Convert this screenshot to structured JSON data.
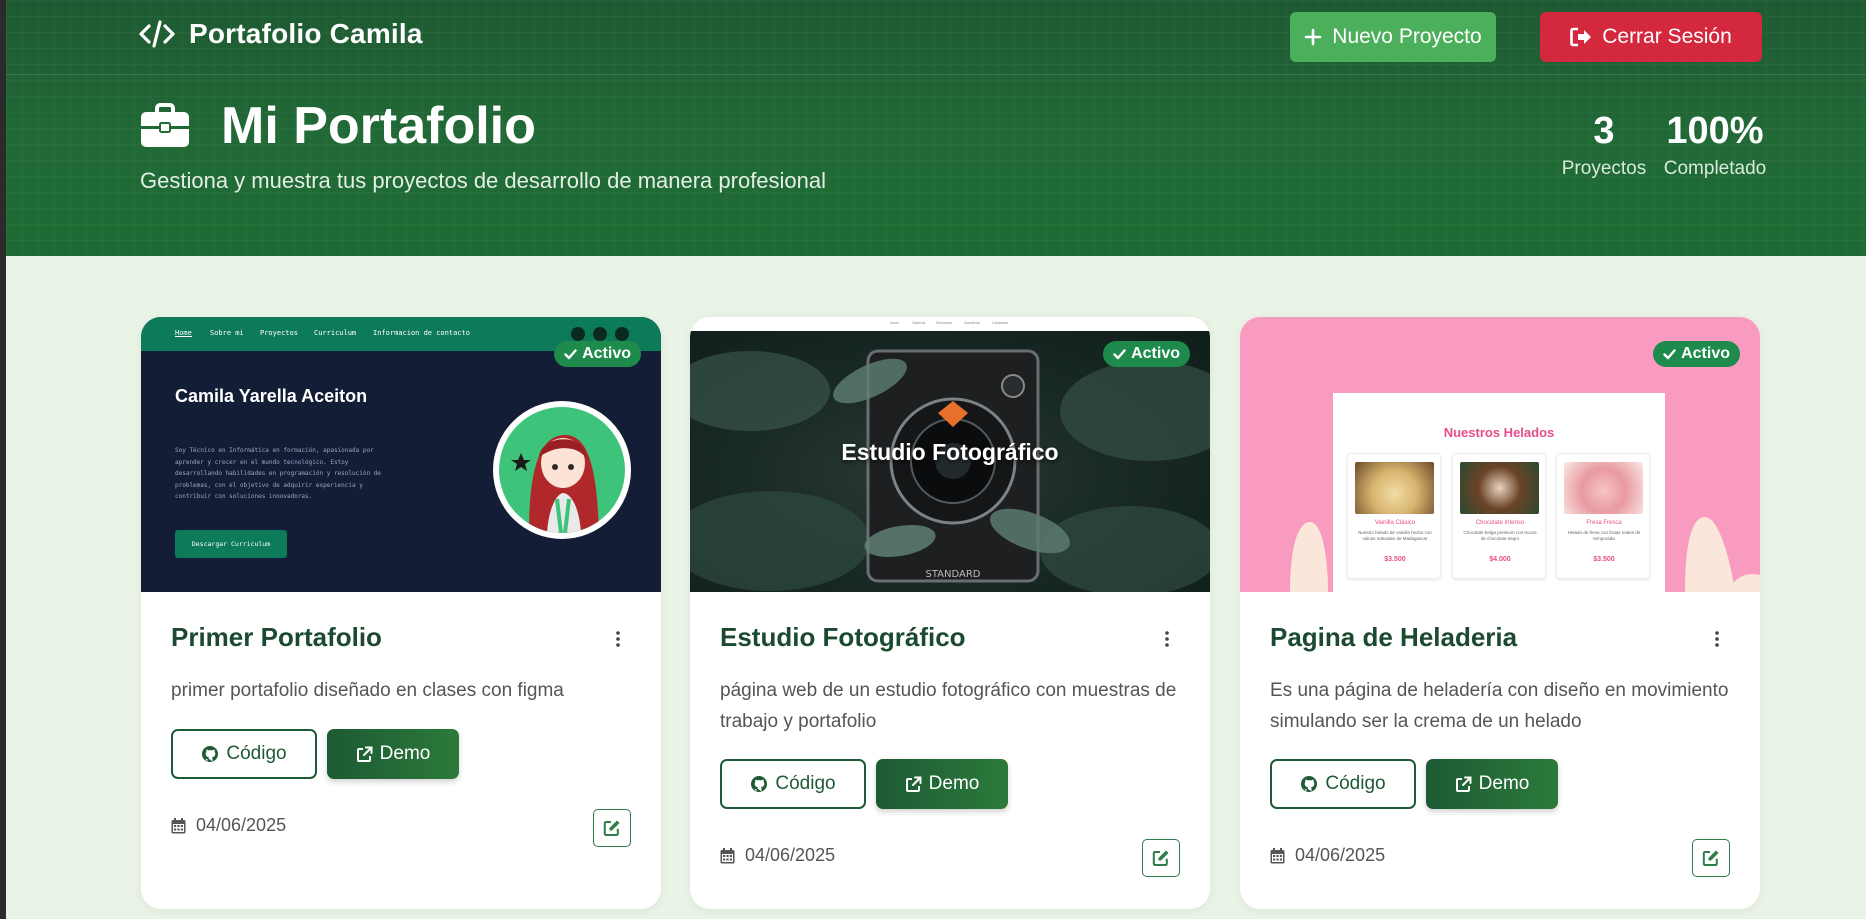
{
  "navbar": {
    "brand": "Portafolio Camila",
    "new_project_label": "Nuevo Proyecto",
    "logout_label": "Cerrar Sesión"
  },
  "hero": {
    "title": "Mi Portafolio",
    "subtitle": "Gestiona y muestra tus proyectos de desarrollo de manera profesional",
    "stats": [
      {
        "value": "3",
        "label": "Proyectos"
      },
      {
        "value": "100%",
        "label": "Completado"
      }
    ]
  },
  "projects": [
    {
      "title": "Primer Portafolio",
      "description": "primer portafolio diseñado en clases con figma",
      "status": "Activo",
      "code_label": "Código",
      "demo_label": "Demo",
      "date": "04/06/2025",
      "thumbnail": {
        "nav_items": [
          "Home",
          "Sobre mi",
          "Proyectos",
          "Curriculum",
          "Informacion de contacto"
        ],
        "name": "Camila Yarella Aceiton",
        "bio": "Soy Técnico en Informática en formación, apasionada por aprender y crecer en el mundo tecnológico. Estoy desarrollando habilidades en programación y resolución de problemas, con el objetivo de adquirir experiencia y contribuir con soluciones innovadoras.",
        "button": "Descargar Curriculum"
      }
    },
    {
      "title": "Estudio Fotográfico",
      "description": "página web de un estudio fotográfico con muestras de trabajo y portafolio",
      "status": "Activo",
      "code_label": "Código",
      "demo_label": "Demo",
      "date": "04/06/2025",
      "thumbnail": {
        "nav_items": [
          "Inicio",
          "Galería",
          "Servicios",
          "Nosotros",
          "Contacto"
        ],
        "heading": "Estudio Fotográfico"
      }
    },
    {
      "title": "Pagina de Heladeria",
      "description": "Es una página de heladería con diseño en movimiento simulando ser la crema de un helado",
      "status": "Activo",
      "code_label": "Código",
      "demo_label": "Demo",
      "date": "04/06/2025",
      "thumbnail": {
        "heading": "Nuestros Helados",
        "items": [
          {
            "name": "Vainilla Clásico",
            "desc": "Nuestro helado de vainilla hecho con vainas naturales de Madagascar",
            "price": "$3.500"
          },
          {
            "name": "Chocolate Intenso",
            "desc": "Chocolate belga premium con trozos de chocolate negro",
            "price": "$4.000"
          },
          {
            "name": "Fresa Fresca",
            "desc": "Helado de fresa con frutas reales de temporada",
            "price": "$3.500"
          }
        ]
      }
    }
  ],
  "colors": {
    "hero_green": "#216a36",
    "new_button": "#4caf5b",
    "logout_button": "#d3283e",
    "badge_green": "#1e8a4c",
    "page_bg": "#eaf4e6"
  },
  "icons": [
    "code-icon",
    "plus-icon",
    "logout-icon",
    "briefcase-icon",
    "check-icon",
    "kebab-icon",
    "github-icon",
    "external-link-icon",
    "calendar-icon",
    "edit-icon"
  ]
}
